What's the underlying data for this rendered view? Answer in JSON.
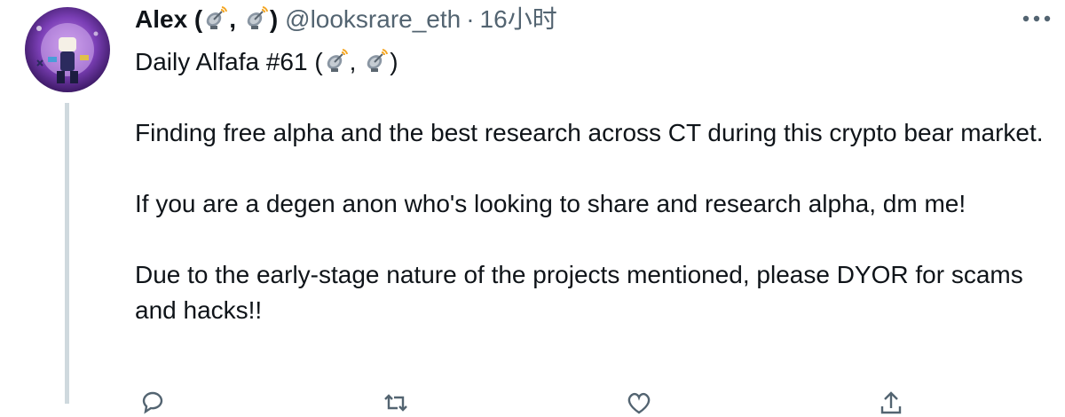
{
  "tweet": {
    "display_name": "Alex (",
    "display_name_sep": ",",
    "display_name_end": ")",
    "handle": "@looksrare_eth",
    "separator": "·",
    "timestamp": "16小时",
    "icons": {
      "name_emoji": "satellite-antenna-icon",
      "more": "more-icon"
    },
    "text": {
      "line1_prefix": "Daily Alfafa #61 (",
      "line1_sep": ",",
      "line1_suffix": ")",
      "para1": "Finding free alpha and the best research across CT during this crypto bear market.",
      "para2": "If you are a degen anon who's looking to share and research alpha, dm me!",
      "para3": "Due to the early-stage nature of the projects mentioned, please DYOR for scams and hacks!!"
    },
    "actions": [
      "reply-icon",
      "retweet-icon",
      "like-icon",
      "share-icon"
    ]
  },
  "colors": {
    "text_primary": "#0f1419",
    "text_secondary": "#536471",
    "thread_line": "#cfd9de",
    "avatar_ring": "#8e44c6"
  }
}
